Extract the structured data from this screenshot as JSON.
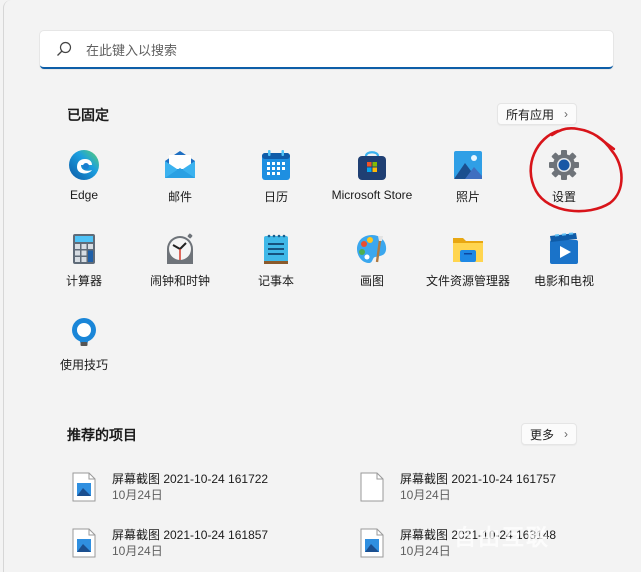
{
  "search": {
    "placeholder": "在此键入以搜索",
    "icon": "search-icon"
  },
  "pinned": {
    "title": "已固定",
    "all_apps_label": "所有应用",
    "all_apps_chevron": "›",
    "apps": [
      {
        "label": "Edge",
        "icon": "edge-icon"
      },
      {
        "label": "邮件",
        "icon": "mail-icon"
      },
      {
        "label": "日历",
        "icon": "calendar-icon"
      },
      {
        "label": "Microsoft Store",
        "icon": "store-icon"
      },
      {
        "label": "照片",
        "icon": "photos-icon"
      },
      {
        "label": "设置",
        "icon": "settings-gear-icon"
      },
      {
        "label": "计算器",
        "icon": "calculator-icon"
      },
      {
        "label": "闹钟和时钟",
        "icon": "alarm-clock-icon"
      },
      {
        "label": "记事本",
        "icon": "notepad-icon"
      },
      {
        "label": "画图",
        "icon": "paint-palette-icon"
      },
      {
        "label": "文件资源管理器",
        "icon": "file-explorer-folder-icon"
      },
      {
        "label": "电影和电视",
        "icon": "movies-tv-icon"
      },
      {
        "label": "使用技巧",
        "icon": "tips-lightbulb-icon"
      }
    ]
  },
  "recommended": {
    "title": "推荐的项目",
    "more_label": "更多",
    "more_chevron": "›",
    "items": [
      {
        "name": "屏幕截图 2021-10-24 161722",
        "date": "10月24日",
        "icon": "image-file-icon"
      },
      {
        "name": "屏幕截图 2021-10-24 161757",
        "date": "10月24日",
        "icon": "blank-file-icon"
      },
      {
        "name": "屏幕截图 2021-10-24 161857",
        "date": "10月24日",
        "icon": "image-file-icon"
      },
      {
        "name": "屏幕截图 2021-10-24 163148",
        "date": "10月24日",
        "icon": "image-file-icon"
      }
    ]
  },
  "annotation": {
    "highlight_color": "#d8141a",
    "target": "设置"
  },
  "watermark": "自由互联",
  "colors": {
    "accent": "#0d5ea8",
    "background": "#f3f3f3"
  }
}
